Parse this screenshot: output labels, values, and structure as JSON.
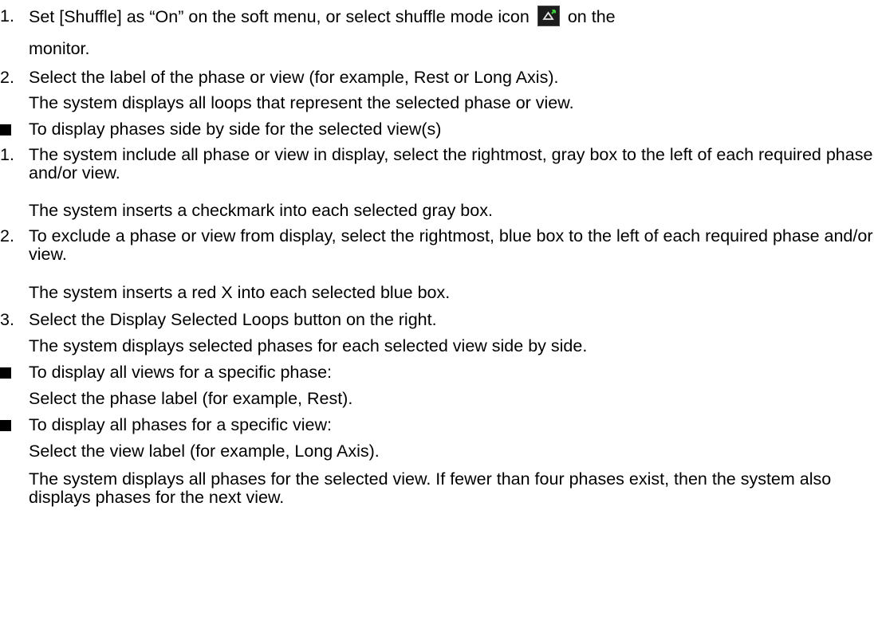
{
  "lines": {
    "l1_num": "1.",
    "l1_a": "Set [Shuffle] as “On” on the soft menu, or select shuffle mode icon",
    "l1_b": "on the",
    "l1_c": "monitor.",
    "l2_num": "2.",
    "l2_a": "Select the label of the phase or view (for example, Rest or Long Axis).",
    "l2_b": "The system displays all loops that represent the selected phase or view.",
    "b1": "To display phases side by side for the selected view(s)",
    "s1_num": "1.",
    "s1_a": "The system include all phase or view in display, select the rightmost, gray box to the left of each required phase and/or view.",
    "s1_b": "The system inserts a checkmark into each selected gray box.",
    "s2_num": "2.",
    "s2_a": "To exclude a phase or view from display, select the rightmost, blue box to the left of each required phase and/or view.",
    "s2_b": "The system inserts a red X into each selected blue box.",
    "s3_num": "3.",
    "s3_a": "Select the Display Selected Loops button on the right.",
    "s3_b": "The system displays selected phases for each selected view side by side.",
    "b2": "To display all views for a specific phase:",
    "b2_a": "Select the phase label (for example, Rest).",
    "b3": "To display all phases for a specific view:",
    "b3_a": "Select the view label (for example, Long Axis).",
    "b3_b": "The system displays all phases for the selected view. If fewer than four phases exist, then the system also displays phases for the next view."
  },
  "icons": {
    "shuffle": "shuffle-mode-icon"
  }
}
